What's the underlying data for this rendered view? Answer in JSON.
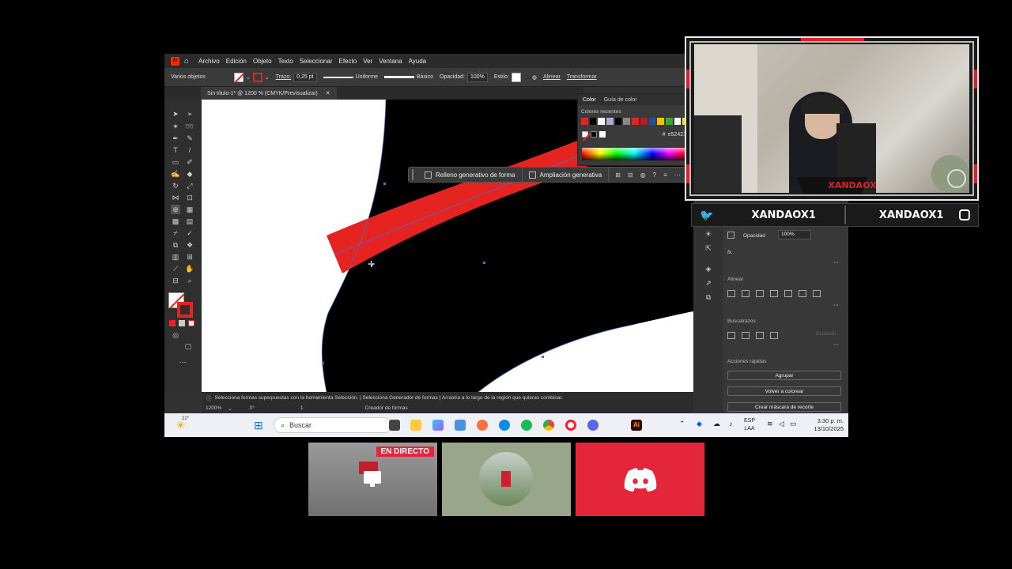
{
  "ai": {
    "logo": "Ai",
    "menu": [
      "Archivo",
      "Edición",
      "Objeto",
      "Texto",
      "Seleccionar",
      "Efecto",
      "Ver",
      "Ventana",
      "Ayuda"
    ],
    "control": {
      "selection": "Varios objetos",
      "stroke_label": "Trazo:",
      "stroke_value": "0,25 pt",
      "profile": "Uniforme",
      "brush": "Básico",
      "opacity_label": "Opacidad:",
      "opacity_value": "100%",
      "style_label": "Estilo:",
      "align": "Alinear",
      "transform": "Transformar"
    },
    "doc_tab": "Sin título-1* @ 1200 % (CMYK/Previsualizar)",
    "color_panel": {
      "tab_active": "Color",
      "tab_other": "Guía de color",
      "recent_label": "Colores recientes",
      "hex": "e52421",
      "recent_colors": [
        "#e52421",
        "#000000",
        "#ffffff",
        "#b3a6d4",
        "#000000",
        "#8a8a8a",
        "#e52421",
        "#b51c2c",
        "#1d4fa3",
        "#f2c400",
        "#3aa635",
        "#ffffff",
        "#f5e400"
      ]
    },
    "gen_bar": {
      "fill": "Relleno generativo de forma",
      "expand": "Ampliación generativa"
    },
    "props": {
      "opacity_label": "Opacidad",
      "opacity_value": "100%",
      "fx": "fx.",
      "align_title": "Alinear",
      "pathfinder_title": "Buscatrazos",
      "expand_label": "Expandir",
      "quick_title": "Acciones rápidas",
      "btn_group": "Agrupar",
      "btn_recolor": "Volver a colorear",
      "btn_mask": "Crear máscara de recorte"
    },
    "status": "Selecciona formas superpuestas con la herramienta Selección.  |  Selecciona Generador de formas  |  Arrastra a lo largo de la región que quieras combinar.",
    "zoom": "1200%",
    "angle": "0°",
    "artboard": "1",
    "tool_name": "Creador de formas"
  },
  "taskbar": {
    "weather": "22°",
    "search_placeholder": "Buscar",
    "lang_top": "ESP",
    "lang_bottom": "LAA",
    "time": "3:30 p. m.",
    "date": "13/10/2025"
  },
  "cam": {
    "overlay_name": "XANDAOX",
    "handle_left": "XANDAOX1",
    "handle_right": "XANDAOX1",
    "accent": "#e0202a"
  },
  "thumbs": {
    "live_badge": "EN DIRECTO"
  }
}
